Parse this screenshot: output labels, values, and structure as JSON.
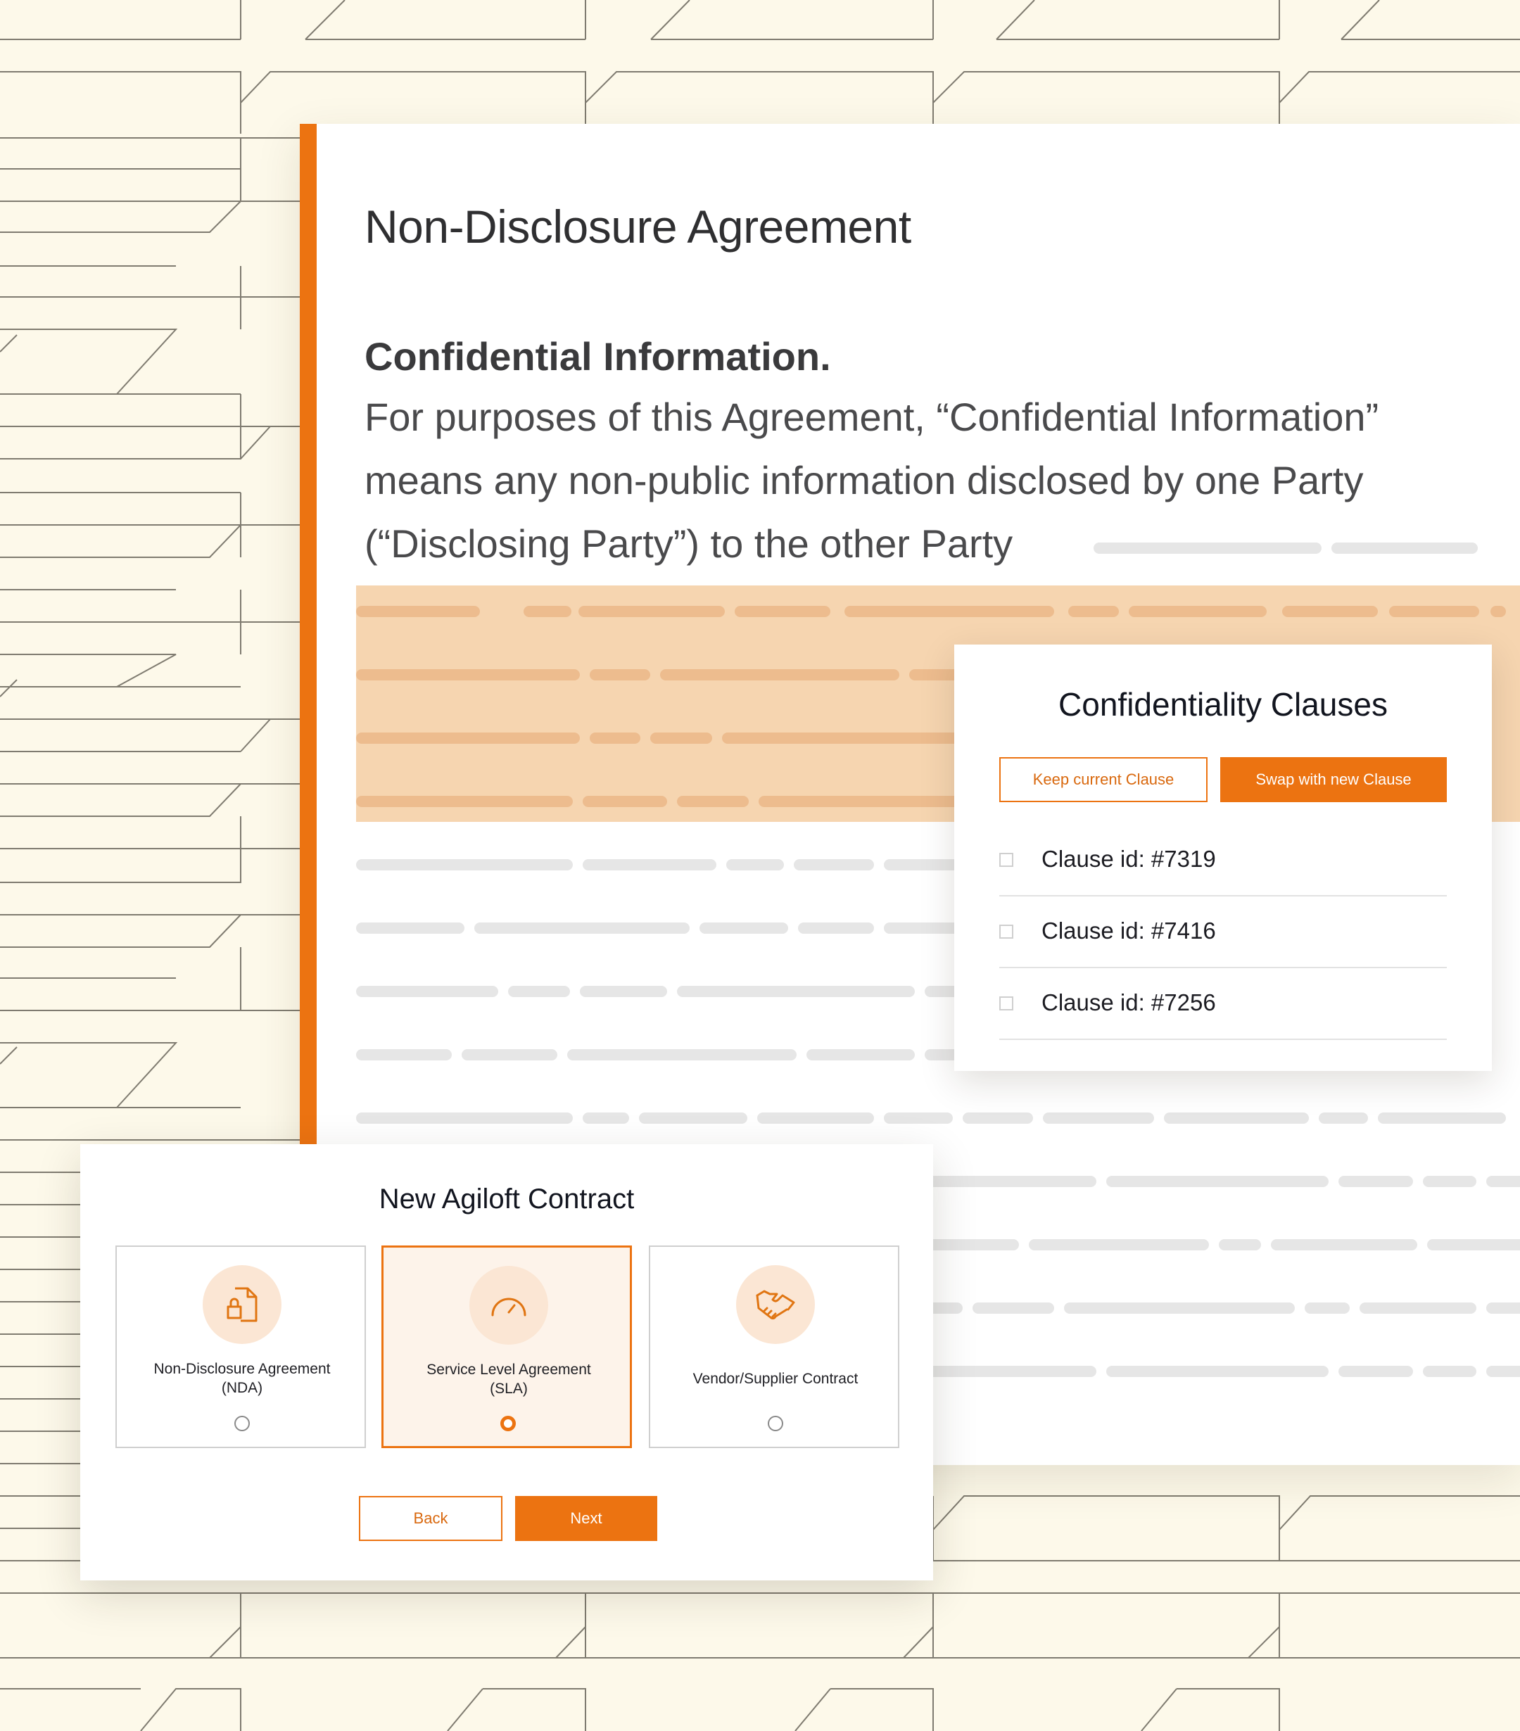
{
  "document": {
    "title": "Non-Disclosure Agreement",
    "section_heading": "Confidential Information.",
    "paragraph_lines": [
      "For purposes of this Agreement, “Confidential Information”",
      "means any non-public information disclosed by one Party",
      "(“Disclosing Party”) to the other Party"
    ]
  },
  "clauses_modal": {
    "title": "Confidentiality Clauses",
    "keep_label": "Keep current Clause",
    "swap_label": "Swap with new Clause",
    "items": [
      {
        "label": "Clause id: #7319",
        "checked": false
      },
      {
        "label": "Clause id: #7416",
        "checked": false
      },
      {
        "label": "Clause id: #7256",
        "checked": false
      }
    ]
  },
  "contract_modal": {
    "title": "New Agiloft Contract",
    "options": [
      {
        "label_line1": "Non-Disclosure Agreement",
        "label_line2": "(NDA)",
        "icon": "document-lock-icon",
        "selected": false
      },
      {
        "label_line1": "Service Level Agreement",
        "label_line2": "(SLA)",
        "icon": "gauge-icon",
        "selected": true
      },
      {
        "label_line1": "Vendor/Supplier Contract",
        "label_line2": "",
        "icon": "handshake-icon",
        "selected": false
      }
    ],
    "back_label": "Back",
    "next_label": "Next"
  },
  "colors": {
    "accent": "#ec7311",
    "highlight": "#f6d5b0",
    "background": "#fdf9ea",
    "icon_circle": "#fbe6d4"
  }
}
